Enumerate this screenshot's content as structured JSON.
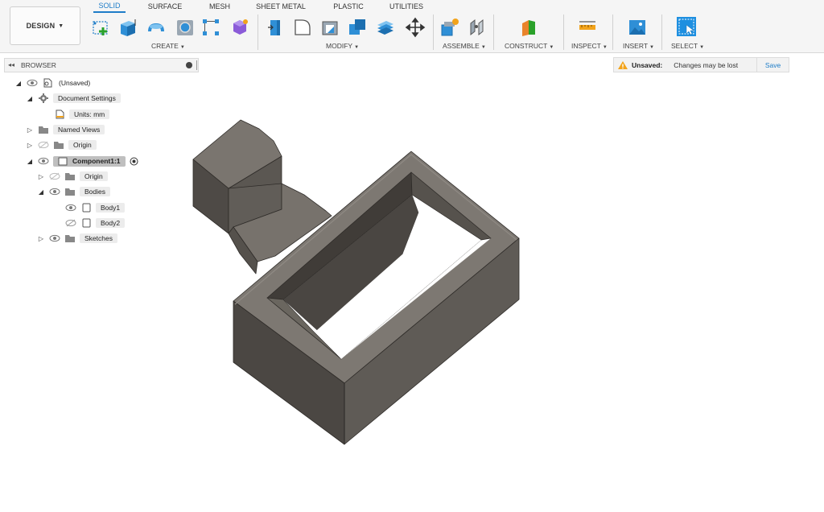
{
  "workspace": {
    "label": "DESIGN"
  },
  "tabs": [
    {
      "label": "SOLID",
      "active": true
    },
    {
      "label": "SURFACE"
    },
    {
      "label": "MESH"
    },
    {
      "label": "SHEET METAL"
    },
    {
      "label": "PLASTIC"
    },
    {
      "label": "UTILITIES"
    }
  ],
  "groups": {
    "create": "CREATE",
    "modify": "MODIFY",
    "assemble": "ASSEMBLE",
    "construct": "CONSTRUCT",
    "inspect": "INSPECT",
    "insert": "INSERT",
    "select": "SELECT"
  },
  "tools": {
    "create": [
      "create-sketch-icon",
      "extrude-icon",
      "revolve-icon",
      "hole-icon",
      "rectangular-pattern-icon",
      "form-icon"
    ],
    "modify": [
      "press-pull-icon",
      "fillet-icon",
      "shell-icon",
      "combine-icon",
      "offset-face-icon",
      "move-icon"
    ],
    "assemble": [
      "new-component-icon",
      "joint-icon"
    ],
    "construct": [
      "offset-plane-icon"
    ],
    "inspect": [
      "measure-icon"
    ],
    "insert": [
      "insert-image-icon"
    ],
    "select": [
      "select-icon"
    ]
  },
  "browser": {
    "title": "BROWSER",
    "tree": {
      "root": "(Unsaved)",
      "document_settings": "Document Settings",
      "units": "Units: mm",
      "named_views": "Named Views",
      "origin": "Origin",
      "component": "Component1:1",
      "comp_origin": "Origin",
      "bodies": "Bodies",
      "body1": "Body1",
      "body2": "Body2",
      "sketches": "Sketches"
    }
  },
  "status": {
    "unsaved_label": "Unsaved:",
    "message": "Changes may be lost",
    "save_label": "Save"
  },
  "colors": {
    "accent": "#1e7dc8",
    "model_top": "#7b7670",
    "model_side_dark": "#524e49",
    "model_side_mid": "#67635d",
    "warning": "#f2a31b"
  }
}
